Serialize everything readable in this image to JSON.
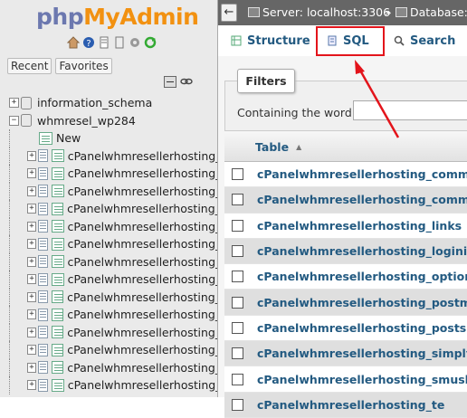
{
  "logo": {
    "php": "php",
    "admin": "MyAdmin"
  },
  "quick_icons": [
    "home-icon",
    "help-icon",
    "docs-icon",
    "settings-icon",
    "reload-icon"
  ],
  "sidebar": {
    "recent_label": "Recent",
    "favorites_label": "Favorites",
    "tree": [
      {
        "type": "db",
        "expander": "+",
        "label": "information_schema"
      },
      {
        "type": "db",
        "expander": "−",
        "label": "whmresel_wp284"
      },
      {
        "type": "new",
        "expander": "",
        "label": "New"
      },
      {
        "type": "table",
        "expander": "+",
        "label": "cPanelwhmresellerhosting_co"
      },
      {
        "type": "table",
        "expander": "+",
        "label": "cPanelwhmresellerhosting_co"
      },
      {
        "type": "table",
        "expander": "+",
        "label": "cPanelwhmresellerhosting_lin"
      },
      {
        "type": "table",
        "expander": "+",
        "label": "cPanelwhmresellerhosting_log"
      },
      {
        "type": "table",
        "expander": "+",
        "label": "cPanelwhmresellerhosting_op"
      },
      {
        "type": "table",
        "expander": "+",
        "label": "cPanelwhmresellerhosting_po"
      },
      {
        "type": "table",
        "expander": "+",
        "label": "cPanelwhmresellerhosting_po"
      },
      {
        "type": "table",
        "expander": "+",
        "label": "cPanelwhmresellerhosting_sir"
      },
      {
        "type": "table",
        "expander": "+",
        "label": "cPanelwhmresellerhosting_sm"
      },
      {
        "type": "table",
        "expander": "+",
        "label": "cPanelwhmresellerhosting_ter"
      },
      {
        "type": "table",
        "expander": "+",
        "label": "cPanelwhmresellerhosting_ter"
      },
      {
        "type": "table",
        "expander": "+",
        "label": "cPanelwhmresellerhosting_ter"
      },
      {
        "type": "table",
        "expander": "+",
        "label": "cPanelwhmresellerhosting_ter"
      },
      {
        "type": "table",
        "expander": "+",
        "label": "cPanelwhmresellerhosting_us"
      }
    ]
  },
  "breadcrumb": {
    "server": "Server: localhost:3306",
    "separator": "»",
    "database": "Database: w"
  },
  "tabs": {
    "structure": "Structure",
    "sql": "SQL",
    "search": "Search"
  },
  "filters": {
    "legend": "Filters",
    "label": "Containing the word:",
    "value": ""
  },
  "table": {
    "header": "Table",
    "rows": [
      "cPanelwhmresellerhosting_comment",
      "cPanelwhmresellerhosting_comment",
      "cPanelwhmresellerhosting_links",
      "cPanelwhmresellerhosting_loginizer_",
      "cPanelwhmresellerhosting_options",
      "cPanelwhmresellerhosting_postmeta",
      "cPanelwhmresellerhosting_posts",
      "cPanelwhmresellerhosting_simply_st",
      "cPanelwhmresellerhosting_smush_di",
      "cPanelwhmresellerhosting_te"
    ]
  },
  "colors": {
    "link": "#235a81",
    "highlight": "#e3141b",
    "topbar": "#666666"
  }
}
